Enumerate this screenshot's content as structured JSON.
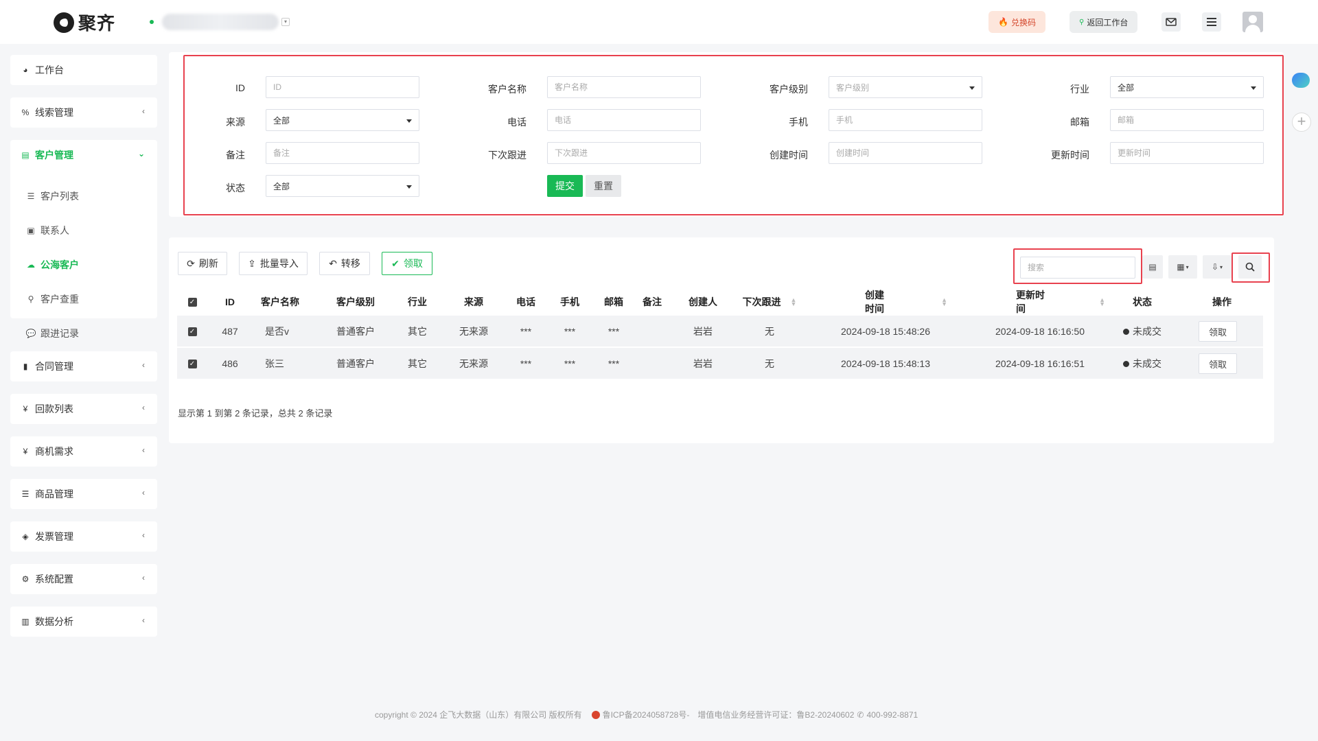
{
  "header": {
    "brand": "聚齐",
    "redeem_label": "兑换码",
    "back_label": "返回工作台"
  },
  "sidebar": {
    "items": [
      {
        "label": "工作台",
        "icon": "dashboard-icon"
      },
      {
        "label": "线索管理",
        "icon": "clue-icon"
      },
      {
        "label": "客户管理",
        "icon": "customer-card-icon"
      },
      {
        "label": "合同管理",
        "icon": "bookmark-icon"
      },
      {
        "label": "回款列表",
        "icon": "yen-icon"
      },
      {
        "label": "商机需求",
        "icon": "yen-icon"
      },
      {
        "label": "商品管理",
        "icon": "list-icon"
      },
      {
        "label": "发票管理",
        "icon": "tag-icon"
      },
      {
        "label": "系统配置",
        "icon": "gears-icon"
      },
      {
        "label": "数据分析",
        "icon": "bar-chart-icon"
      }
    ],
    "sub_items": [
      {
        "label": "客户列表",
        "icon": "list-icon"
      },
      {
        "label": "联系人",
        "icon": "contact-icon"
      },
      {
        "label": "公海客户",
        "icon": "cloud-icon"
      },
      {
        "label": "客户查重",
        "icon": "search-icon"
      },
      {
        "label": "跟进记录",
        "icon": "comments-icon"
      }
    ]
  },
  "filter": {
    "id_label": "ID",
    "id_placeholder": "ID",
    "name_label": "客户名称",
    "name_placeholder": "客户名称",
    "level_label": "客户级别",
    "level_placeholder": "客户级别",
    "industry_label": "行业",
    "industry_value": "全部",
    "source_label": "来源",
    "source_value": "全部",
    "phone_label": "电话",
    "phone_placeholder": "电话",
    "mobile_label": "手机",
    "mobile_placeholder": "手机",
    "email_label": "邮箱",
    "email_placeholder": "邮箱",
    "remark_label": "备注",
    "remark_placeholder": "备注",
    "next_label": "下次跟进",
    "next_placeholder": "下次跟进",
    "created_label": "创建时间",
    "created_placeholder": "创建时间",
    "updated_label": "更新时间",
    "updated_placeholder": "更新时间",
    "status_label": "状态",
    "status_value": "全部",
    "submit_label": "提交",
    "reset_label": "重置"
  },
  "toolbar": {
    "refresh_label": "刷新",
    "import_label": "批量导入",
    "transfer_label": "转移",
    "claim_label": "领取",
    "search_placeholder": "搜索"
  },
  "table": {
    "headers": [
      "ID",
      "客户名称",
      "客户级别",
      "行业",
      "来源",
      "电话",
      "手机",
      "邮箱",
      "备注",
      "创建人",
      "下次跟进",
      "创建时间",
      "更新时间",
      "状态",
      "操作"
    ],
    "rows": [
      {
        "id": "487",
        "name": "是否v",
        "level": "普通客户",
        "industry": "其它",
        "source": "无来源",
        "phone": "***",
        "mobile": "***",
        "email": "***",
        "remark": "",
        "creator": "岩岩",
        "next": "无",
        "created": "2024-09-18 15:48:26",
        "updated": "2024-09-18 16:16:50",
        "status": "未成交",
        "action": "领取"
      },
      {
        "id": "486",
        "name": "张三",
        "level": "普通客户",
        "industry": "其它",
        "source": "无来源",
        "phone": "***",
        "mobile": "***",
        "email": "***",
        "remark": "",
        "creator": "岩岩",
        "next": "无",
        "created": "2024-09-18 15:48:13",
        "updated": "2024-09-18 16:16:51",
        "status": "未成交",
        "action": "领取"
      }
    ],
    "pager_text": "显示第 1 到第 2 条记录，总共 2 条记录"
  },
  "footer": {
    "copyright": "copyright © 2024 企飞大数据（山东）有限公司 版权所有",
    "icp": "鲁ICP备2024058728号-",
    "license": "增值电信业务经营许可证：鲁B2-20240602",
    "phone": "400-992-8871"
  },
  "colors": {
    "accent": "#19b955",
    "highlight": "#e8414e"
  }
}
